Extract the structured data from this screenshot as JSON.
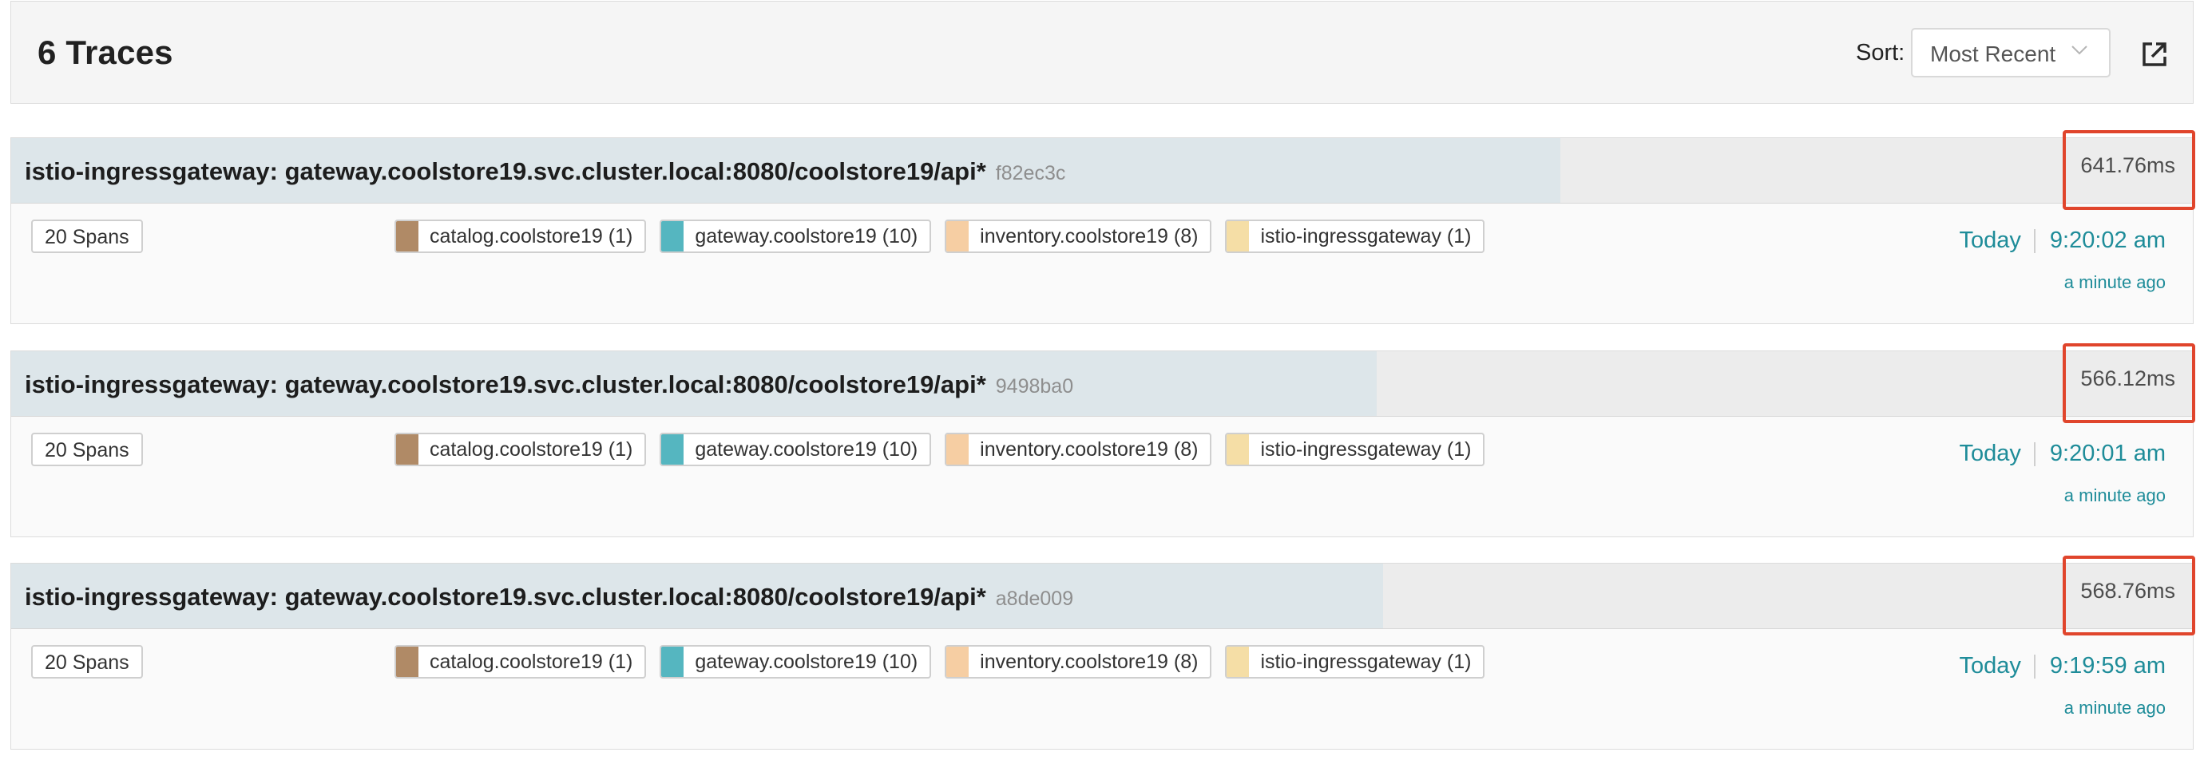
{
  "header": {
    "title": "6 Traces",
    "sort_label": "Sort:",
    "sort_value": "Most Recent"
  },
  "traces": [
    {
      "name": "istio-ingressgateway: gateway.coolstore19.svc.cluster.local:8080/coolstore19/api*",
      "id": "f82ec3c",
      "duration": "641.76ms",
      "duration_fraction": 0.71,
      "spans": "20 Spans",
      "services": [
        {
          "label": "catalog.coolstore19 (1)",
          "color": "#b08a66"
        },
        {
          "label": "gateway.coolstore19 (10)",
          "color": "#55b6c0"
        },
        {
          "label": "inventory.coolstore19 (8)",
          "color": "#f6cea3"
        },
        {
          "label": "istio-ingressgateway (1)",
          "color": "#f5dea6"
        }
      ],
      "day": "Today",
      "time": "9:20:02 am",
      "ago": "a minute ago"
    },
    {
      "name": "istio-ingressgateway: gateway.coolstore19.svc.cluster.local:8080/coolstore19/api*",
      "id": "9498ba0",
      "duration": "566.12ms",
      "duration_fraction": 0.626,
      "spans": "20 Spans",
      "services": [
        {
          "label": "catalog.coolstore19 (1)",
          "color": "#b08a66"
        },
        {
          "label": "gateway.coolstore19 (10)",
          "color": "#55b6c0"
        },
        {
          "label": "inventory.coolstore19 (8)",
          "color": "#f6cea3"
        },
        {
          "label": "istio-ingressgateway (1)",
          "color": "#f5dea6"
        }
      ],
      "day": "Today",
      "time": "9:20:01 am",
      "ago": "a minute ago"
    },
    {
      "name": "istio-ingressgateway: gateway.coolstore19.svc.cluster.local:8080/coolstore19/api*",
      "id": "a8de009",
      "duration": "568.76ms",
      "duration_fraction": 0.629,
      "spans": "20 Spans",
      "services": [
        {
          "label": "catalog.coolstore19 (1)",
          "color": "#b08a66"
        },
        {
          "label": "gateway.coolstore19 (10)",
          "color": "#55b6c0"
        },
        {
          "label": "inventory.coolstore19 (8)",
          "color": "#f6cea3"
        },
        {
          "label": "istio-ingressgateway (1)",
          "color": "#f5dea6"
        }
      ],
      "day": "Today",
      "time": "9:19:59 am",
      "ago": "a minute ago"
    }
  ],
  "icons": {
    "sort_chevron": "chevron-down-icon",
    "open_external": "external-link-icon"
  }
}
